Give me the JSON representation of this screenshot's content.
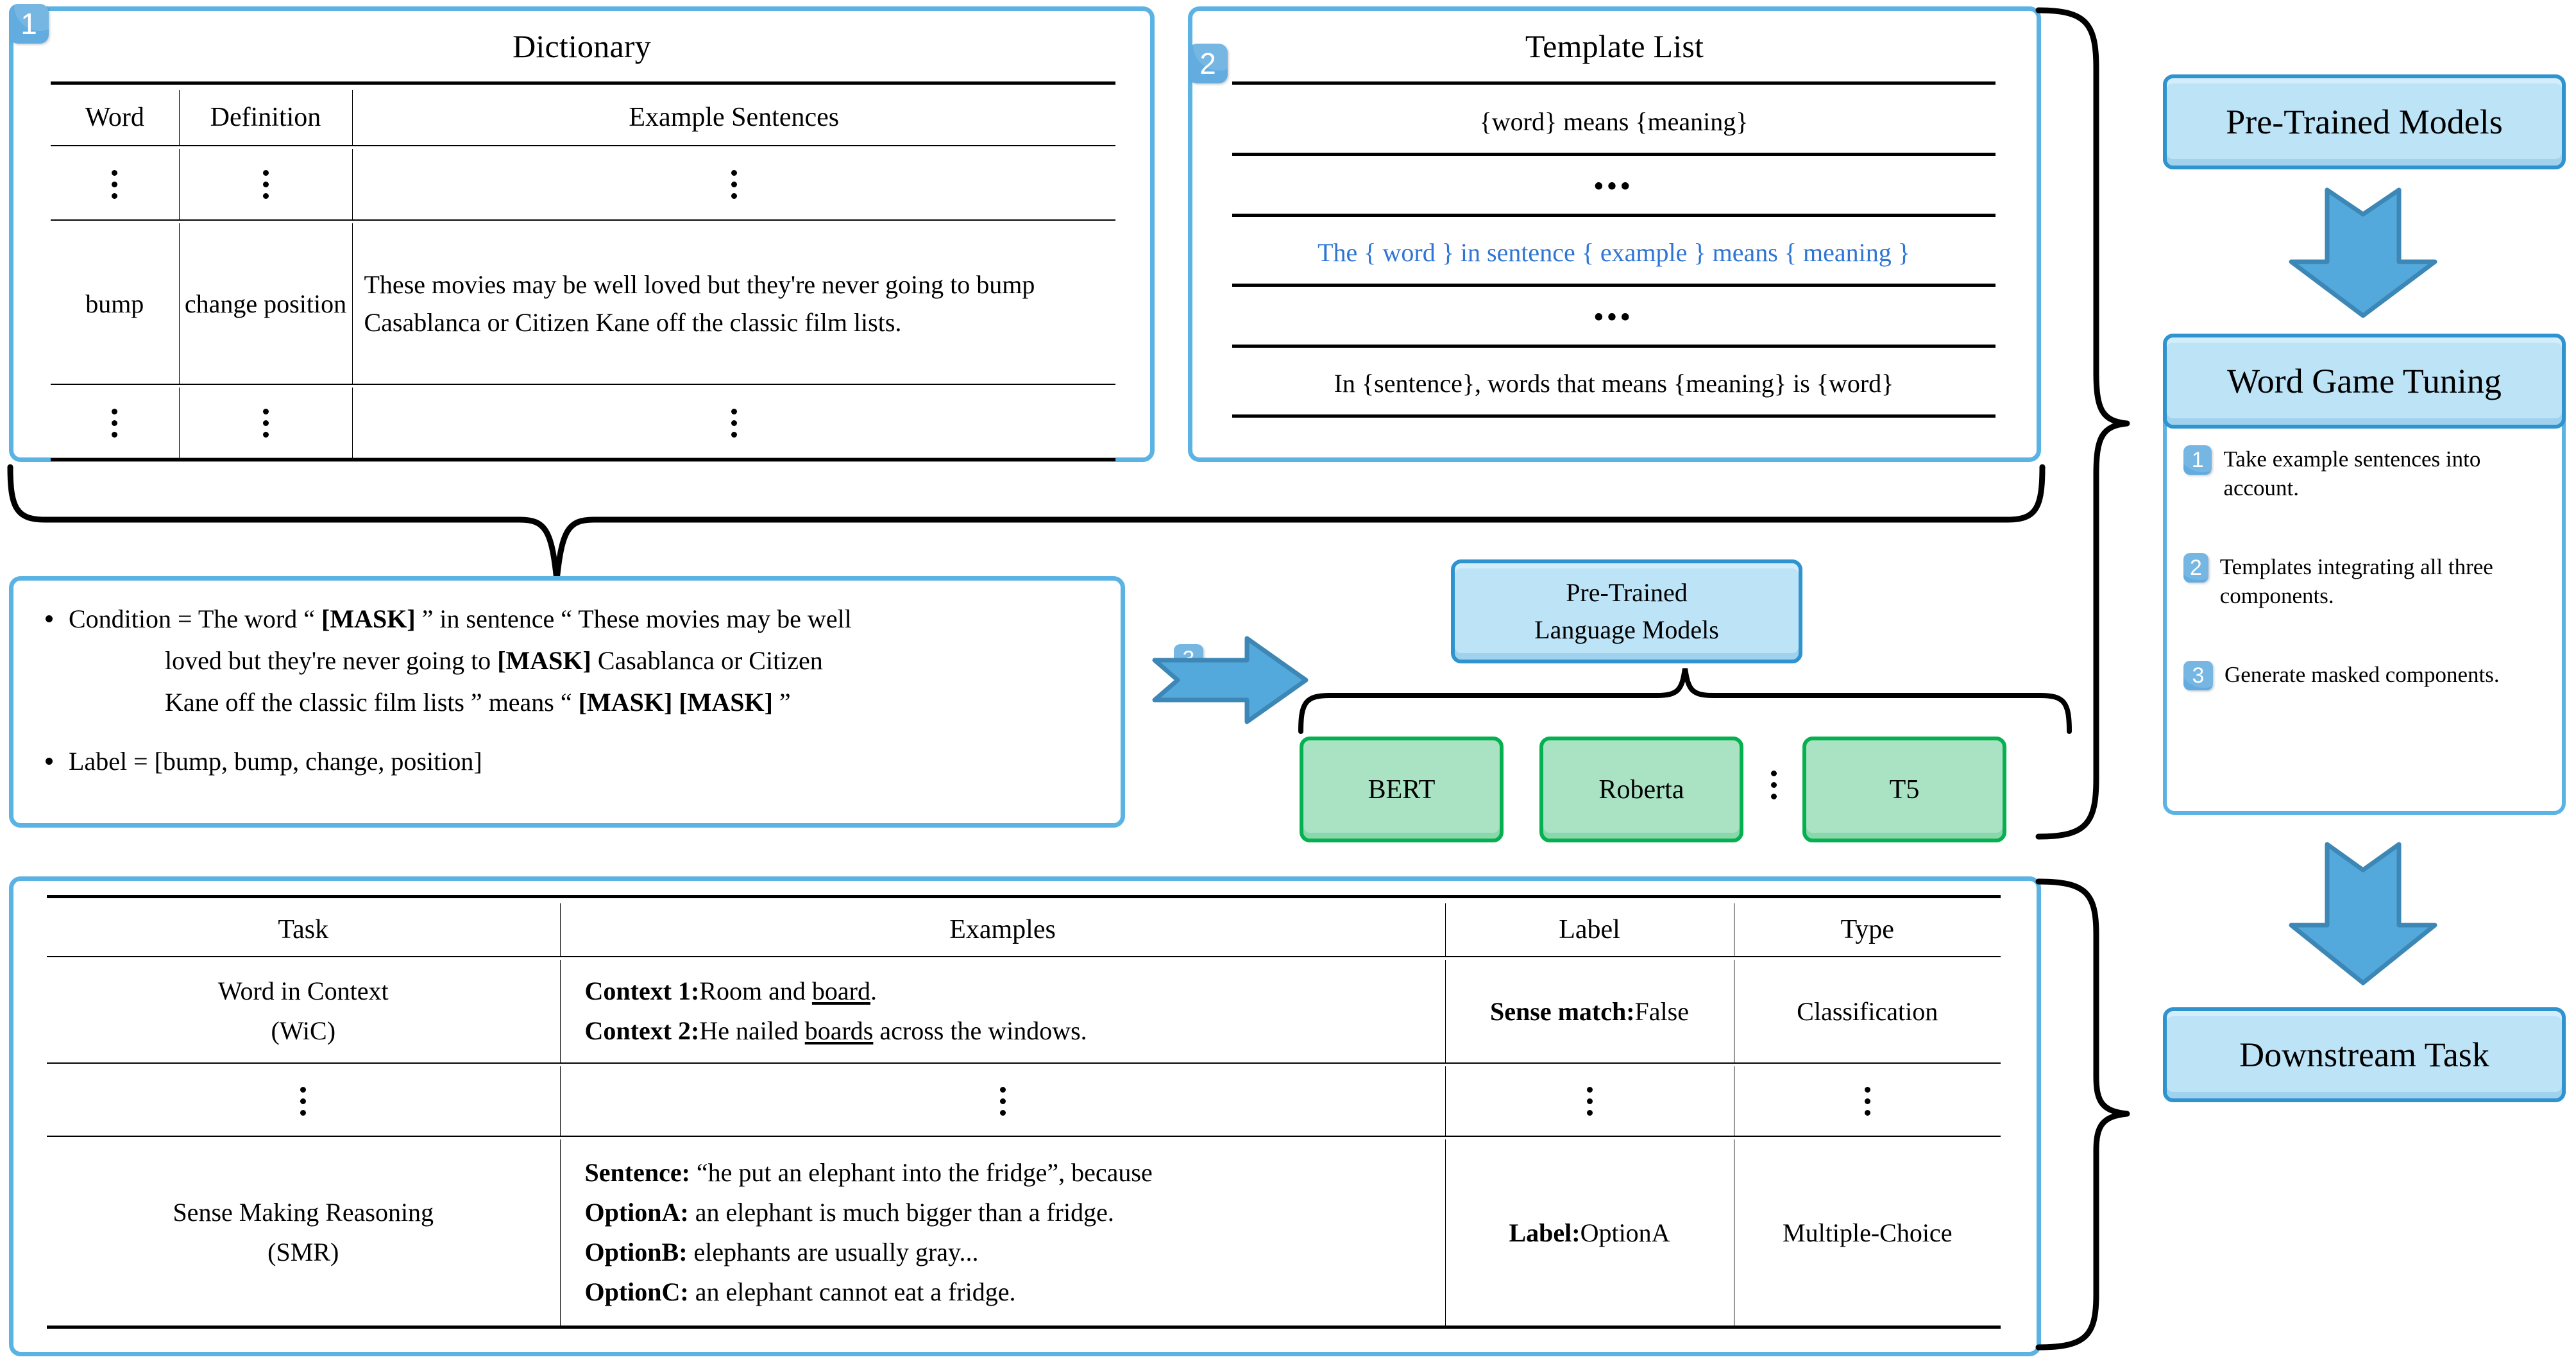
{
  "colors": {
    "panel_border": "#5BB3E4",
    "badge": "#63ACE0",
    "process_box_fill": "#BDE3F7",
    "process_box_border": "#2E93CE",
    "model_box_fill": "#A9E3C3",
    "model_box_border": "#06B050",
    "arrow": "#54A9DC",
    "highlight_template": "#2E75D4"
  },
  "dictionary": {
    "badge": "1",
    "title": "Dictionary",
    "columns": [
      "Word",
      "Definition",
      "Example Sentences"
    ],
    "rows": [
      {
        "word": "⋮",
        "definition": "⋮",
        "example": "⋮",
        "is_dots": true
      },
      {
        "word": "bump",
        "definition": "change position",
        "example": "These movies may be well loved but they're never going to bump Casablanca or Citizen Kane off the classic film lists.",
        "is_dots": false
      },
      {
        "word": "⋮",
        "definition": "⋮",
        "example": "⋮",
        "is_dots": true
      }
    ]
  },
  "template_list": {
    "badge": "2",
    "title": "Template List",
    "rows": [
      {
        "text": "{word} means {meaning}",
        "highlight": false,
        "dots": false
      },
      {
        "text": "•••",
        "highlight": false,
        "dots": true
      },
      {
        "text": "The { word } in sentence { example } means { meaning }",
        "highlight": true,
        "dots": false
      },
      {
        "text": "•••",
        "highlight": false,
        "dots": true
      },
      {
        "text": "In {sentence}, words that means {meaning} is {word}",
        "highlight": false,
        "dots": false
      }
    ]
  },
  "condition_box": {
    "condition_label": "Condition =",
    "condition_line1_a": "The word “ ",
    "condition_mask1": "[MASK]",
    "condition_line1_b": " ” in sentence “ These movies may be well",
    "condition_line2_a": "loved but they're never going to ",
    "condition_mask2": "[MASK]",
    "condition_line2_b": " Casablanca or Citizen",
    "condition_line3_a": "Kane off the classic film lists ” means “ ",
    "condition_mask3": "[MASK]",
    "condition_mask4": "[MASK]",
    "condition_line3_b": " ”",
    "label_line": "Label = [bump, bump, change, position]"
  },
  "step3": {
    "badge": "3",
    "arrow": "right-arrow-icon"
  },
  "plm": {
    "title_line1": "Pre-Trained",
    "title_line2": "Language Models",
    "models": [
      "BERT",
      "Roberta",
      "T5"
    ],
    "dots": "⋮"
  },
  "pipeline": {
    "pretrained_models": "Pre-Trained Models",
    "word_game_tuning": "Word Game Tuning",
    "downstream_task": "Downstream Task",
    "steps": [
      {
        "num": "1",
        "text": "Take example sentences into account."
      },
      {
        "num": "2",
        "text": "Templates integrating all three components."
      },
      {
        "num": "3",
        "text": "Generate masked components."
      }
    ]
  },
  "task_table": {
    "columns": [
      "Task",
      "Examples",
      "Label",
      "Type"
    ],
    "rows": [
      {
        "task_line1": "Word in Context",
        "task_line2": "(WiC)",
        "examples": [
          {
            "bold": "Context 1:",
            "rest_pre": "Room and ",
            "underline": "board",
            "rest_post": "."
          },
          {
            "bold": "Context 2:",
            "rest_pre": "He nailed ",
            "underline": "boards",
            "rest_post": " across the windows."
          }
        ],
        "label_bold": "Sense match:",
        "label_rest": "False",
        "type": "Classification"
      },
      {
        "is_dots": true,
        "dots": "⋮"
      },
      {
        "task_line1": "Sense Making Reasoning",
        "task_line2": "(SMR)",
        "examples": [
          {
            "bold": "Sentence:",
            "rest_pre": " “he put an elephant into the fridge”, because",
            "underline": "",
            "rest_post": ""
          },
          {
            "bold": "OptionA:",
            "rest_pre": " an elephant is much bigger than a fridge.",
            "underline": "",
            "rest_post": ""
          },
          {
            "bold": "OptionB:",
            "rest_pre": " elephants are usually gray...",
            "underline": "",
            "rest_post": ""
          },
          {
            "bold": "OptionC:",
            "rest_pre": " an elephant cannot eat a fridge.",
            "underline": "",
            "rest_post": ""
          }
        ],
        "label_bold": "Label:",
        "label_rest": "OptionA",
        "type": "Multiple-Choice"
      }
    ]
  }
}
